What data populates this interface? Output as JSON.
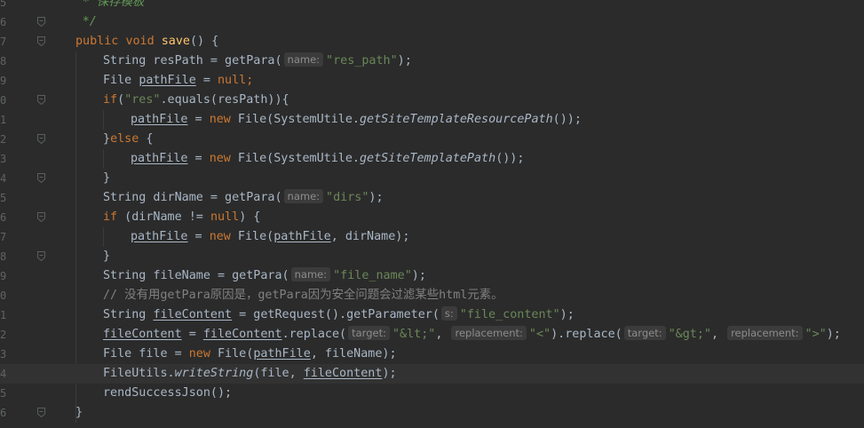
{
  "editor": {
    "lines": [
      {
        "num": "5",
        "fold": false,
        "current": false,
        "code": "     * 保存模板"
      },
      {
        "num": "6",
        "fold": true,
        "current": false,
        "code": "     */"
      },
      {
        "num": "7",
        "fold": true,
        "current": false,
        "code": "    public void save() {"
      },
      {
        "num": "8",
        "fold": false,
        "current": false,
        "code": "        String resPath = getPara( name: \"res_path\");"
      },
      {
        "num": "9",
        "fold": false,
        "current": false,
        "code": "        File pathFile = null;"
      },
      {
        "num": "0",
        "fold": true,
        "current": false,
        "code": "        if(\"res\".equals(resPath)){"
      },
      {
        "num": "1",
        "fold": false,
        "current": false,
        "code": "            pathFile = new File(SystemUtile.getSiteTemplateResourcePath());"
      },
      {
        "num": "2",
        "fold": true,
        "current": false,
        "code": "        }else {"
      },
      {
        "num": "3",
        "fold": false,
        "current": false,
        "code": "            pathFile = new File(SystemUtile.getSiteTemplatePath());"
      },
      {
        "num": "4",
        "fold": true,
        "current": false,
        "code": "        }"
      },
      {
        "num": "5",
        "fold": false,
        "current": false,
        "code": "        String dirName = getPara( name: \"dirs\");"
      },
      {
        "num": "6",
        "fold": true,
        "current": false,
        "code": "        if (dirName != null) {"
      },
      {
        "num": "7",
        "fold": false,
        "current": false,
        "code": "            pathFile = new File(pathFile, dirName);"
      },
      {
        "num": "8",
        "fold": true,
        "current": false,
        "code": "        }"
      },
      {
        "num": "9",
        "fold": false,
        "current": false,
        "code": "        String fileName = getPara( name: \"file_name\");"
      },
      {
        "num": "0",
        "fold": false,
        "current": false,
        "code": "        // 没有用getPara原因是，getPara因为安全问题会过滤某些html元素。"
      },
      {
        "num": "1",
        "fold": false,
        "current": false,
        "code": "        String fileContent = getRequest().getParameter( s: \"file_content\");"
      },
      {
        "num": "2",
        "fold": false,
        "current": false,
        "code": "        fileContent = fileContent.replace( target: \"&lt;\",  replacement: \"<\").replace( target: \"&gt;\",  replacement: \">\");"
      },
      {
        "num": "3",
        "fold": false,
        "current": false,
        "code": "        File file = new File(pathFile, fileName);"
      },
      {
        "num": "4",
        "fold": false,
        "current": true,
        "code": "        FileUtils.writeString(file, fileContent);"
      },
      {
        "num": "5",
        "fold": false,
        "current": false,
        "code": "        rendSuccessJson();"
      },
      {
        "num": "6",
        "fold": true,
        "current": false,
        "code": "    }"
      }
    ]
  },
  "tokens": {
    "l0": [
      {
        "t": "* 保存模板",
        "c": "doc"
      }
    ],
    "l1": [
      {
        "t": "*/",
        "c": "doc"
      }
    ],
    "l2": [
      {
        "t": "public",
        "c": "kw"
      },
      {
        "t": " "
      },
      {
        "t": "void",
        "c": "kw"
      },
      {
        "t": " "
      },
      {
        "t": "save",
        "c": "fn"
      },
      {
        "t": "() {"
      }
    ],
    "l3": [
      {
        "t": "String resPath = getPara("
      },
      {
        "t": "name:",
        "c": "hint"
      },
      {
        "t": "\"res_path\"",
        "c": "str"
      },
      {
        "t": ");"
      }
    ],
    "l4": [
      {
        "t": "File "
      },
      {
        "t": "pathFile",
        "c": "ul"
      },
      {
        "t": " = "
      },
      {
        "t": "null",
        "c": "kw"
      },
      {
        "t": ";",
        "c": "kw"
      }
    ],
    "l5": [
      {
        "t": "if",
        "c": "kw"
      },
      {
        "t": "("
      },
      {
        "t": "\"res\"",
        "c": "str"
      },
      {
        "t": ".equals(resPath)){"
      }
    ],
    "l6": [
      {
        "t": "pathFile",
        "c": "ul"
      },
      {
        "t": " = "
      },
      {
        "t": "new",
        "c": "kw"
      },
      {
        "t": " File(SystemUtile."
      },
      {
        "t": "getSiteTemplateResourcePath",
        "c": "it"
      },
      {
        "t": "());"
      }
    ],
    "l7": [
      {
        "t": "}"
      },
      {
        "t": "else",
        "c": "kw"
      },
      {
        "t": " {"
      }
    ],
    "l8": [
      {
        "t": "pathFile",
        "c": "ul"
      },
      {
        "t": " = "
      },
      {
        "t": "new",
        "c": "kw"
      },
      {
        "t": " File(SystemUtile."
      },
      {
        "t": "getSiteTemplatePath",
        "c": "it"
      },
      {
        "t": "());"
      }
    ],
    "l9": [
      {
        "t": "}"
      }
    ],
    "l10": [
      {
        "t": "String dirName = getPara("
      },
      {
        "t": "name:",
        "c": "hint"
      },
      {
        "t": "\"dirs\"",
        "c": "str"
      },
      {
        "t": ");"
      }
    ],
    "l11": [
      {
        "t": "if",
        "c": "kw"
      },
      {
        "t": " (dirName != "
      },
      {
        "t": "null",
        "c": "kw"
      },
      {
        "t": ") {"
      }
    ],
    "l12": [
      {
        "t": "pathFile",
        "c": "ul"
      },
      {
        "t": " = "
      },
      {
        "t": "new",
        "c": "kw"
      },
      {
        "t": " File("
      },
      {
        "t": "pathFile",
        "c": "ul"
      },
      {
        "t": ", dirName);"
      }
    ],
    "l13": [
      {
        "t": "}"
      }
    ],
    "l14": [
      {
        "t": "String fileName = getPara("
      },
      {
        "t": "name:",
        "c": "hint"
      },
      {
        "t": "\"file_name\"",
        "c": "str"
      },
      {
        "t": ");"
      }
    ],
    "l15": [
      {
        "t": "// 没有用getPara原因是，getPara因为安全问题会过滤某些html元素。",
        "c": "cm"
      }
    ],
    "l16": [
      {
        "t": "String "
      },
      {
        "t": "fileContent",
        "c": "ul"
      },
      {
        "t": " = getRequest().getParameter("
      },
      {
        "t": "s:",
        "c": "hint"
      },
      {
        "t": "\"file_content\"",
        "c": "str"
      },
      {
        "t": ");"
      }
    ],
    "l17": [
      {
        "t": "fileContent",
        "c": "ul"
      },
      {
        "t": " = "
      },
      {
        "t": "fileContent",
        "c": "ul"
      },
      {
        "t": ".replace("
      },
      {
        "t": "target:",
        "c": "hint"
      },
      {
        "t": "\"&lt;\"",
        "c": "str"
      },
      {
        "t": ", "
      },
      {
        "t": "replacement:",
        "c": "hint"
      },
      {
        "t": "\"<\"",
        "c": "str"
      },
      {
        "t": ").replace("
      },
      {
        "t": "target:",
        "c": "hint"
      },
      {
        "t": "\"&gt;\"",
        "c": "str"
      },
      {
        "t": ", "
      },
      {
        "t": "replacement:",
        "c": "hint"
      },
      {
        "t": "\">\"",
        "c": "str"
      },
      {
        "t": ");"
      }
    ],
    "l18": [
      {
        "t": "File file = "
      },
      {
        "t": "new",
        "c": "kw"
      },
      {
        "t": " File("
      },
      {
        "t": "pathFile",
        "c": "ul"
      },
      {
        "t": ", fileName);"
      }
    ],
    "l19": [
      {
        "t": "FileUtils."
      },
      {
        "t": "writeString",
        "c": "it"
      },
      {
        "t": "(file, "
      },
      {
        "t": "fileContent",
        "c": "ul"
      },
      {
        "t": ");"
      }
    ],
    "l20": [
      {
        "t": "rendSuccessJson();"
      }
    ],
    "l21": [
      {
        "t": "}"
      }
    ]
  },
  "colors": {
    "background": "#2b2b2b",
    "current_line": "#323232",
    "keyword": "#cc7832",
    "string": "#6a8759",
    "method_decl": "#ffc66d",
    "comment": "#808080",
    "doc_comment": "#629755",
    "plain": "#a9b7c6",
    "line_number": "#606366"
  }
}
